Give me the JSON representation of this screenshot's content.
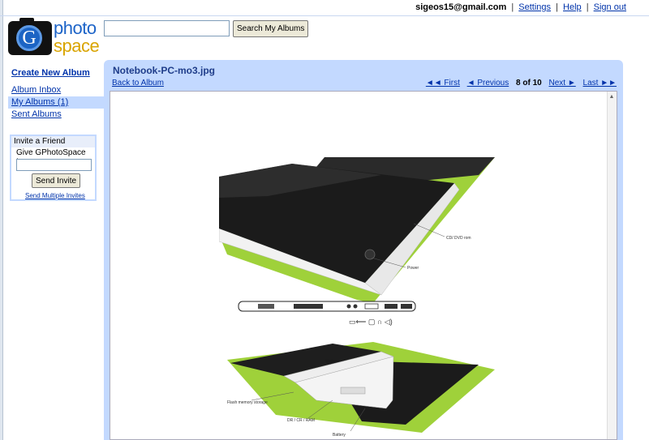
{
  "header": {
    "email": "sigeos15@gmail.com",
    "settings": "Settings",
    "help": "Help",
    "signout": "Sign out"
  },
  "logo": {
    "letter": "G",
    "word1": "photo",
    "word2": "space"
  },
  "search": {
    "value": "",
    "button": "Search My Albums"
  },
  "sidebar": {
    "create": "Create New Album",
    "items": [
      {
        "label": "Album Inbox"
      },
      {
        "label": "My Albums (1)"
      },
      {
        "label": "Sent Albums"
      }
    ],
    "selected_index": 1
  },
  "invite": {
    "title": "Invite a Friend",
    "give_label": "Give GPhotoSpace to:",
    "value": "",
    "button": "Send Invite",
    "multi": "Send Multiple Invites"
  },
  "viewer": {
    "title": "Notebook-PC-mo3.jpg",
    "back": "Back to  Album",
    "first": "◄◄ First",
    "previous": "◄ Previous",
    "counter": "8 of 10",
    "next": "Next ►",
    "last": "Last ►►"
  },
  "photo_labels": {
    "cd": "CD/ DVD rom",
    "power": "Power",
    "flash": "Flash memory storage",
    "dr": "DR / CR / RAM",
    "battery": "Battery"
  },
  "colors": {
    "panel": "#c3d9ff",
    "link": "#0033aa",
    "lime": "#9fd13a"
  }
}
